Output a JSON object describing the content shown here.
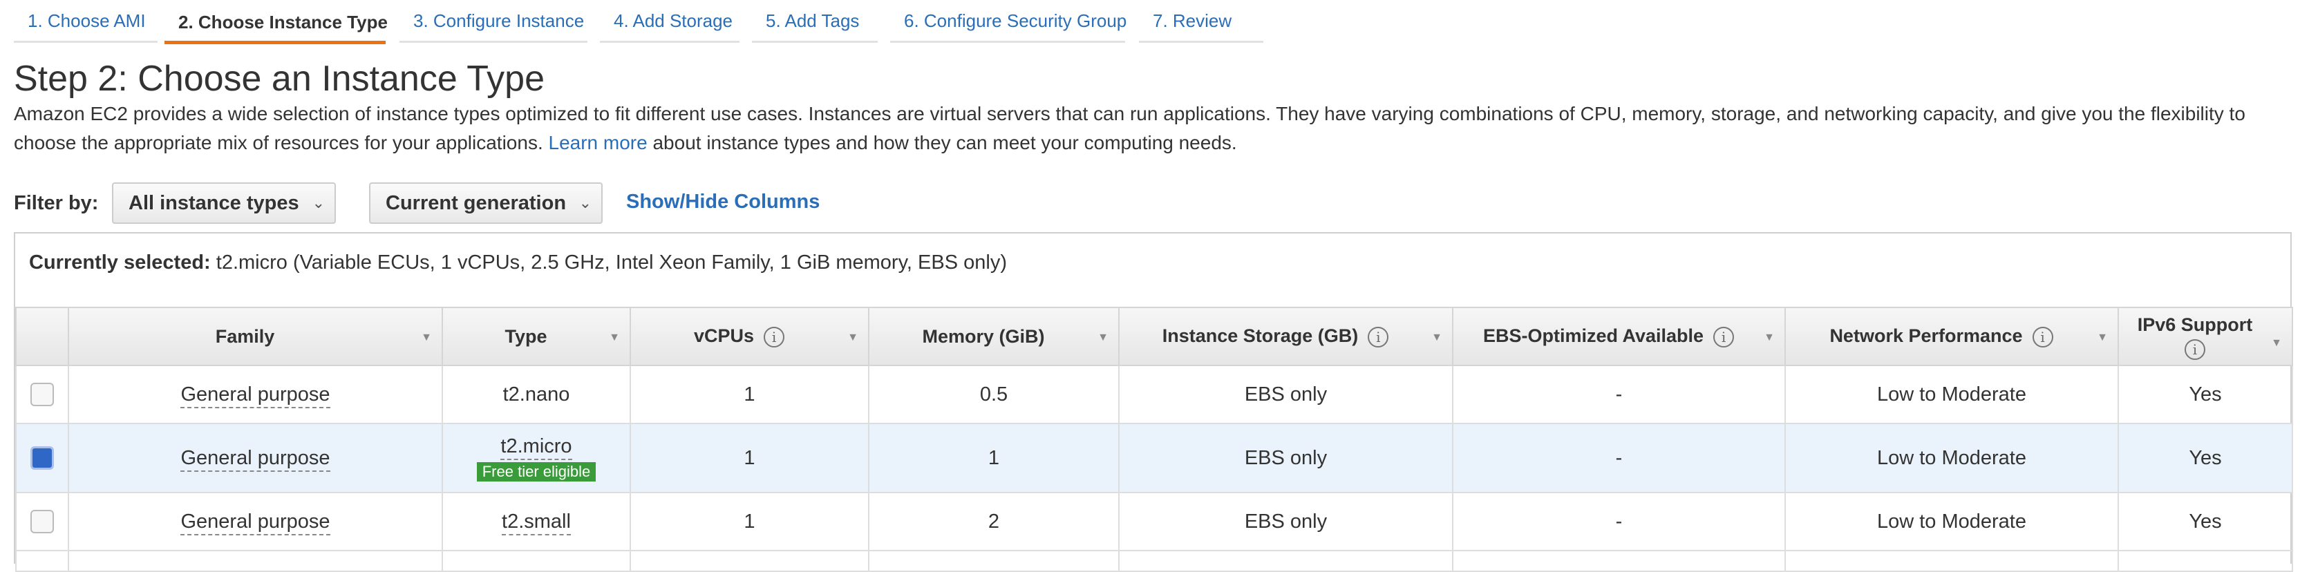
{
  "tabs": [
    {
      "label": "1. Choose AMI"
    },
    {
      "label": "2. Choose Instance Type"
    },
    {
      "label": "3. Configure Instance"
    },
    {
      "label": "4. Add Storage"
    },
    {
      "label": "5. Add Tags"
    },
    {
      "label": "6. Configure Security Group"
    },
    {
      "label": "7. Review"
    }
  ],
  "page": {
    "title": "Step 2: Choose an Instance Type",
    "description_before": "Amazon EC2 provides a wide selection of instance types optimized to fit different use cases. Instances are virtual servers that can run applications. They have varying combinations of CPU, memory, storage, and networking capacity, and give you the flexibility to choose the appropriate mix of resources for your applications.",
    "learn_more": "Learn more",
    "description_after": "about instance types and how they can meet your computing needs."
  },
  "filter": {
    "label": "Filter by:",
    "type_select": "All instance types",
    "generation_select": "Current generation",
    "show_hide": "Show/Hide Columns"
  },
  "selection": {
    "label": "Currently selected:",
    "value": "t2.micro (Variable ECUs, 1 vCPUs, 2.5 GHz, Intel Xeon Family, 1 GiB memory, EBS only)"
  },
  "table": {
    "columns": [
      "Family",
      "Type",
      "vCPUs",
      "Memory (GiB)",
      "Instance Storage (GB)",
      "EBS-Optimized Available",
      "Network Performance",
      "IPv6 Support"
    ],
    "info_glyph": "i",
    "rows": [
      {
        "family": "General purpose",
        "type": "t2.nano",
        "badge": "",
        "vcpus": "1",
        "memory": "0.5",
        "storage": "EBS only",
        "ebs": "-",
        "network": "Low to Moderate",
        "ipv6": "Yes",
        "checked": false
      },
      {
        "family": "General purpose",
        "type": "t2.micro",
        "badge": "Free tier eligible",
        "vcpus": "1",
        "memory": "1",
        "storage": "EBS only",
        "ebs": "-",
        "network": "Low to Moderate",
        "ipv6": "Yes",
        "checked": true
      },
      {
        "family": "General purpose",
        "type": "t2.small",
        "badge": "",
        "vcpus": "1",
        "memory": "2",
        "storage": "EBS only",
        "ebs": "-",
        "network": "Low to Moderate",
        "ipv6": "Yes",
        "checked": false
      }
    ]
  },
  "colors": {
    "link": "#2a6eb8",
    "active_tab_underline": "#ec7211",
    "selected_row": "#eaf3fb",
    "checkbox_checked": "#2f67c7",
    "badge": "#3a9b3a"
  },
  "icons": [
    "info-icon",
    "sort-icon",
    "chevron-down-icon",
    "checkbox-icon"
  ]
}
